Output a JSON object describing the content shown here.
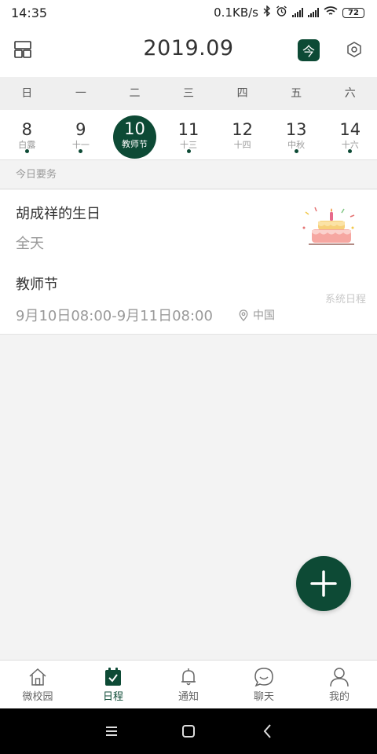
{
  "status_bar": {
    "time": "14:35",
    "network_speed": "0.1KB/s",
    "battery": "72"
  },
  "header": {
    "title": "2019.09",
    "today_label": "今",
    "left_icon": "grid-icon",
    "right_icon": "hexagon-settings-icon"
  },
  "weekdays": [
    "日",
    "一",
    "二",
    "三",
    "四",
    "五",
    "六"
  ],
  "dates": [
    {
      "day": "8",
      "lunar": "白露",
      "has_event": true,
      "selected": false
    },
    {
      "day": "9",
      "lunar": "十一",
      "has_event": true,
      "selected": false
    },
    {
      "day": "10",
      "lunar": "教师节",
      "has_event": false,
      "selected": true
    },
    {
      "day": "11",
      "lunar": "十三",
      "has_event": true,
      "selected": false
    },
    {
      "day": "12",
      "lunar": "十四",
      "has_event": false,
      "selected": false
    },
    {
      "day": "13",
      "lunar": "中秋",
      "has_event": true,
      "selected": false
    },
    {
      "day": "14",
      "lunar": "十六",
      "has_event": true,
      "selected": false
    }
  ],
  "section": {
    "title": "今日要务"
  },
  "events": [
    {
      "name": "胡成祥的生日",
      "time": "全天",
      "image": "birthday-cake-illustration"
    },
    {
      "name": "教师节",
      "time": "9月10日08:00-9月11日08:00",
      "location": "中国",
      "tag": "系统日程"
    }
  ],
  "bottom_nav": [
    {
      "label": "微校园",
      "icon": "home-icon",
      "active": false
    },
    {
      "label": "日程",
      "icon": "calendar-check-icon",
      "active": true
    },
    {
      "label": "通知",
      "icon": "bell-icon",
      "active": false
    },
    {
      "label": "聊天",
      "icon": "chat-icon",
      "active": false
    },
    {
      "label": "我的",
      "icon": "user-icon",
      "active": false
    }
  ],
  "colors": {
    "primary": "#0d4a35",
    "background": "#f3f3f3",
    "text": "#333333",
    "muted": "#999999"
  }
}
